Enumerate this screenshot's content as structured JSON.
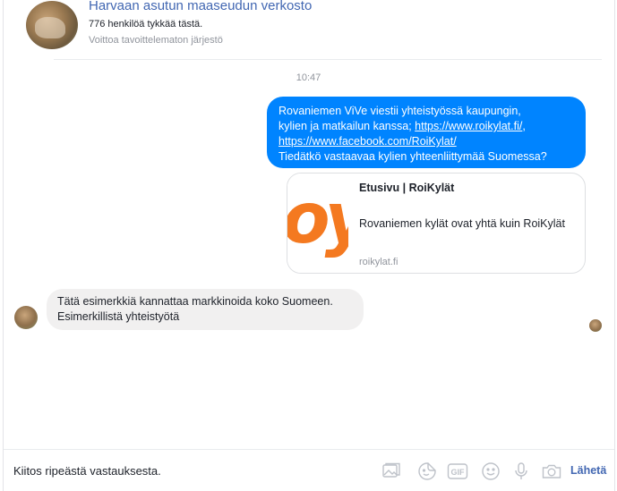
{
  "header": {
    "page_name": "Harvaan asutun maaseudun verkosto",
    "likes": "776 henkilöä tykkää tästä.",
    "category": "Voittoa tavoittelematon järjestö"
  },
  "conversation": {
    "timestamp": "10:47",
    "outgoing": {
      "line1": "Rovaniemen  ViVe viestii yhteistyössä kaupungin,",
      "line2_text": "kylien ja matkailun kanssa; ",
      "link1": "https://www.roikylat.fi/",
      "line2_suffix": ",",
      "link2": "https://www.facebook.com/RoiKylat/",
      "line4": " Tiedätkö vastaavaa kylien yhteenliittymää Suomessa?"
    },
    "link_preview": {
      "title": "Etusivu | RoiKylät",
      "description": "Rovaniemen kylät ovat yhtä kuin RoiKylät",
      "domain": "roikylat.fi",
      "thumbnail_glyph": "oyt"
    },
    "incoming": {
      "text": "Tätä esimerkkiä kannattaa markkinoida koko Suomeen. Esimerkillistä yhteistyötä"
    }
  },
  "composer": {
    "message_value": "Kiitos ripeästä vastauksesta.",
    "send_label": "Lähetä",
    "icons": [
      "image-icon",
      "sticker-icon",
      "gif-icon",
      "emoji-icon",
      "microphone-icon",
      "camera-icon"
    ]
  },
  "colors": {
    "accent": "#0084ff",
    "link": "#4267b2",
    "incoming_bubble": "#f1f0f0",
    "brand_orange": "#f47920"
  }
}
